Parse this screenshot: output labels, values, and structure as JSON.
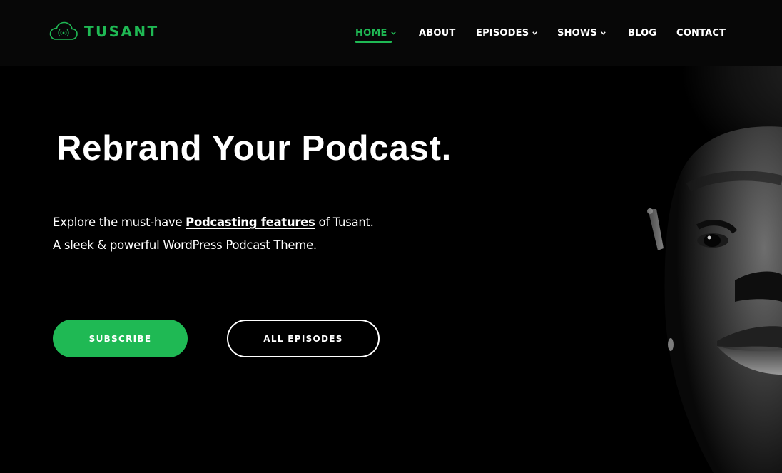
{
  "brand": {
    "name": "TUSANT",
    "logo_icon": "cloud-broadcast-icon",
    "accent_color": "#1fb954"
  },
  "nav": {
    "items": [
      {
        "label": "HOME",
        "has_dropdown": true,
        "active": true
      },
      {
        "label": "ABOUT",
        "has_dropdown": false,
        "active": false
      },
      {
        "label": "EPISODES",
        "has_dropdown": true,
        "active": false
      },
      {
        "label": "SHOWS",
        "has_dropdown": true,
        "active": false
      },
      {
        "label": "BLOG",
        "has_dropdown": false,
        "active": false
      },
      {
        "label": "CONTACT",
        "has_dropdown": false,
        "active": false
      }
    ]
  },
  "hero": {
    "title": "Rebrand Your Podcast.",
    "desc_prefix": "Explore the must-have ",
    "desc_link": "Podcasting features",
    "desc_suffix": " of Tusant.",
    "desc_line2": "A sleek & powerful WordPress Podcast Theme.",
    "image": "black-and-white-portrait-photo",
    "buttons": {
      "subscribe": "SUBSCRIBE",
      "all_episodes": "ALL EPISODES"
    }
  }
}
